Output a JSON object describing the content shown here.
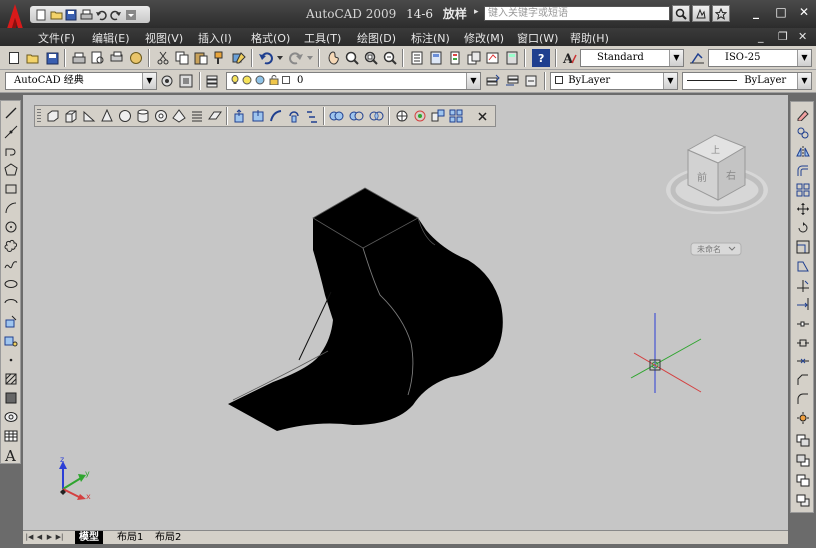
{
  "titlebar": {
    "app_name": "AutoCAD 2009",
    "drawing_name": "14-6",
    "doc_state": "放样",
    "search_placeholder": "键入关键字或短语"
  },
  "menu": [
    {
      "label": "文件(F)"
    },
    {
      "label": "编辑(E)"
    },
    {
      "label": "视图(V)"
    },
    {
      "label": "插入(I)"
    },
    {
      "label": "格式(O)"
    },
    {
      "label": "工具(T)"
    },
    {
      "label": "绘图(D)"
    },
    {
      "label": "标注(N)"
    },
    {
      "label": "修改(M)"
    },
    {
      "label": "窗口(W)"
    },
    {
      "label": "帮助(H)"
    }
  ],
  "styles": {
    "text_style": "Standard",
    "dim_style": "ISO-25"
  },
  "workspace": "AutoCAD 经典",
  "layer": {
    "current": "0"
  },
  "properties": {
    "color": "ByLayer",
    "linetype": "ByLayer"
  },
  "viewcube": {
    "face_top": "上",
    "face_front": "前",
    "face_right": "右",
    "wcs_label": "未命名"
  },
  "ucs": {
    "x_label": "x",
    "y_label": "y",
    "z_label": "z"
  },
  "tabs": [
    {
      "label": "模型",
      "active": true
    },
    {
      "label": "布局1",
      "active": false
    },
    {
      "label": "布局2",
      "active": false
    }
  ],
  "colors": {
    "canvas_bg": "#c6c6c6",
    "titlebar_bg": "#2c2c2c",
    "toolbar_bg": "#d4d0c8",
    "solid_fill": "#000000",
    "axis_x": "#d44040",
    "axis_y": "#2fa52f",
    "axis_z": "#2c3fd6"
  }
}
